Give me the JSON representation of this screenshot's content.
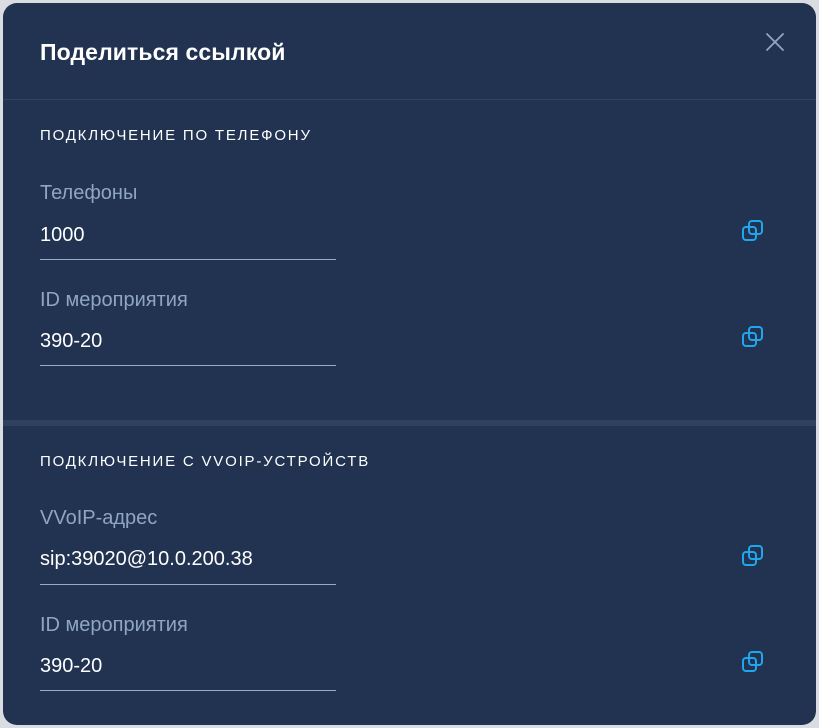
{
  "dialog": {
    "title": "Поделиться ссылкой",
    "close_icon": "close-icon"
  },
  "phone_section": {
    "title": "ПОДКЛЮЧЕНИЕ ПО ТЕЛЕФОНУ",
    "fields": [
      {
        "label": "Телефоны",
        "value": "1000",
        "copy_icon": "copy-icon"
      },
      {
        "label": "ID мероприятия",
        "value": "390-20",
        "copy_icon": "copy-icon"
      }
    ]
  },
  "vvoip_section": {
    "title": "ПОДКЛЮЧЕНИЕ С VVOIP-УСТРОЙСТВ",
    "fields": [
      {
        "label": "VVoIP-адрес",
        "value": "sip:39020@10.0.200.38",
        "copy_icon": "copy-icon"
      },
      {
        "label": "ID мероприятия",
        "value": "390-20",
        "copy_icon": "copy-icon"
      }
    ]
  },
  "colors": {
    "background": "#213350",
    "label": "#8fa6c3",
    "accent": "#1fa6ec",
    "text": "#ffffff"
  }
}
